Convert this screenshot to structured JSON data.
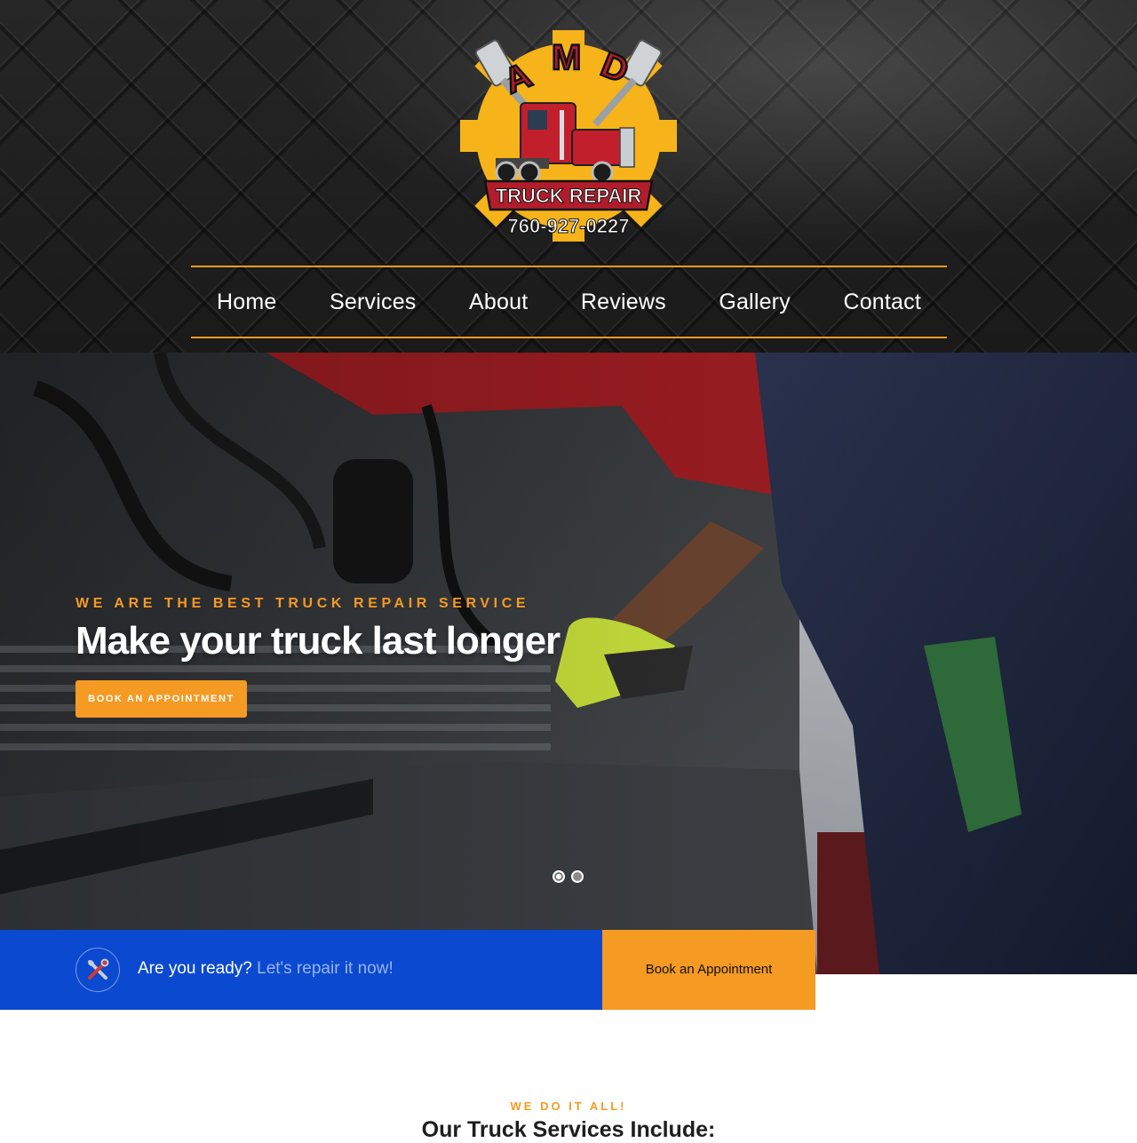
{
  "brand": {
    "logo_top_text": "AMD",
    "logo_banner_text": "TRUCK REPAIR",
    "logo_phone": "760-927-0227",
    "colors": {
      "accent": "#f59a23",
      "blue": "#0a49d0",
      "logo_red": "#b21d2b",
      "logo_yellow": "#f7b31a"
    }
  },
  "nav": {
    "items": [
      {
        "label": "Home"
      },
      {
        "label": "Services"
      },
      {
        "label": "About"
      },
      {
        "label": "Reviews"
      },
      {
        "label": "Gallery"
      },
      {
        "label": "Contact"
      }
    ]
  },
  "hero": {
    "tagline": "WE ARE THE BEST TRUCK REPAIR SERVICE",
    "title": "Make your truck last longer",
    "cta_label": "BOOK AN APPOINTMENT",
    "slider": {
      "slide_count": 2,
      "active_slide": 1
    }
  },
  "ready_bar": {
    "icon": "tools-icon",
    "question": "Are you ready?",
    "accent_text": "Let's repair it now!",
    "book_label": "Book an Appointment"
  },
  "services": {
    "eyebrow": "WE DO IT ALL!",
    "title": "Our Truck Services Include:"
  }
}
